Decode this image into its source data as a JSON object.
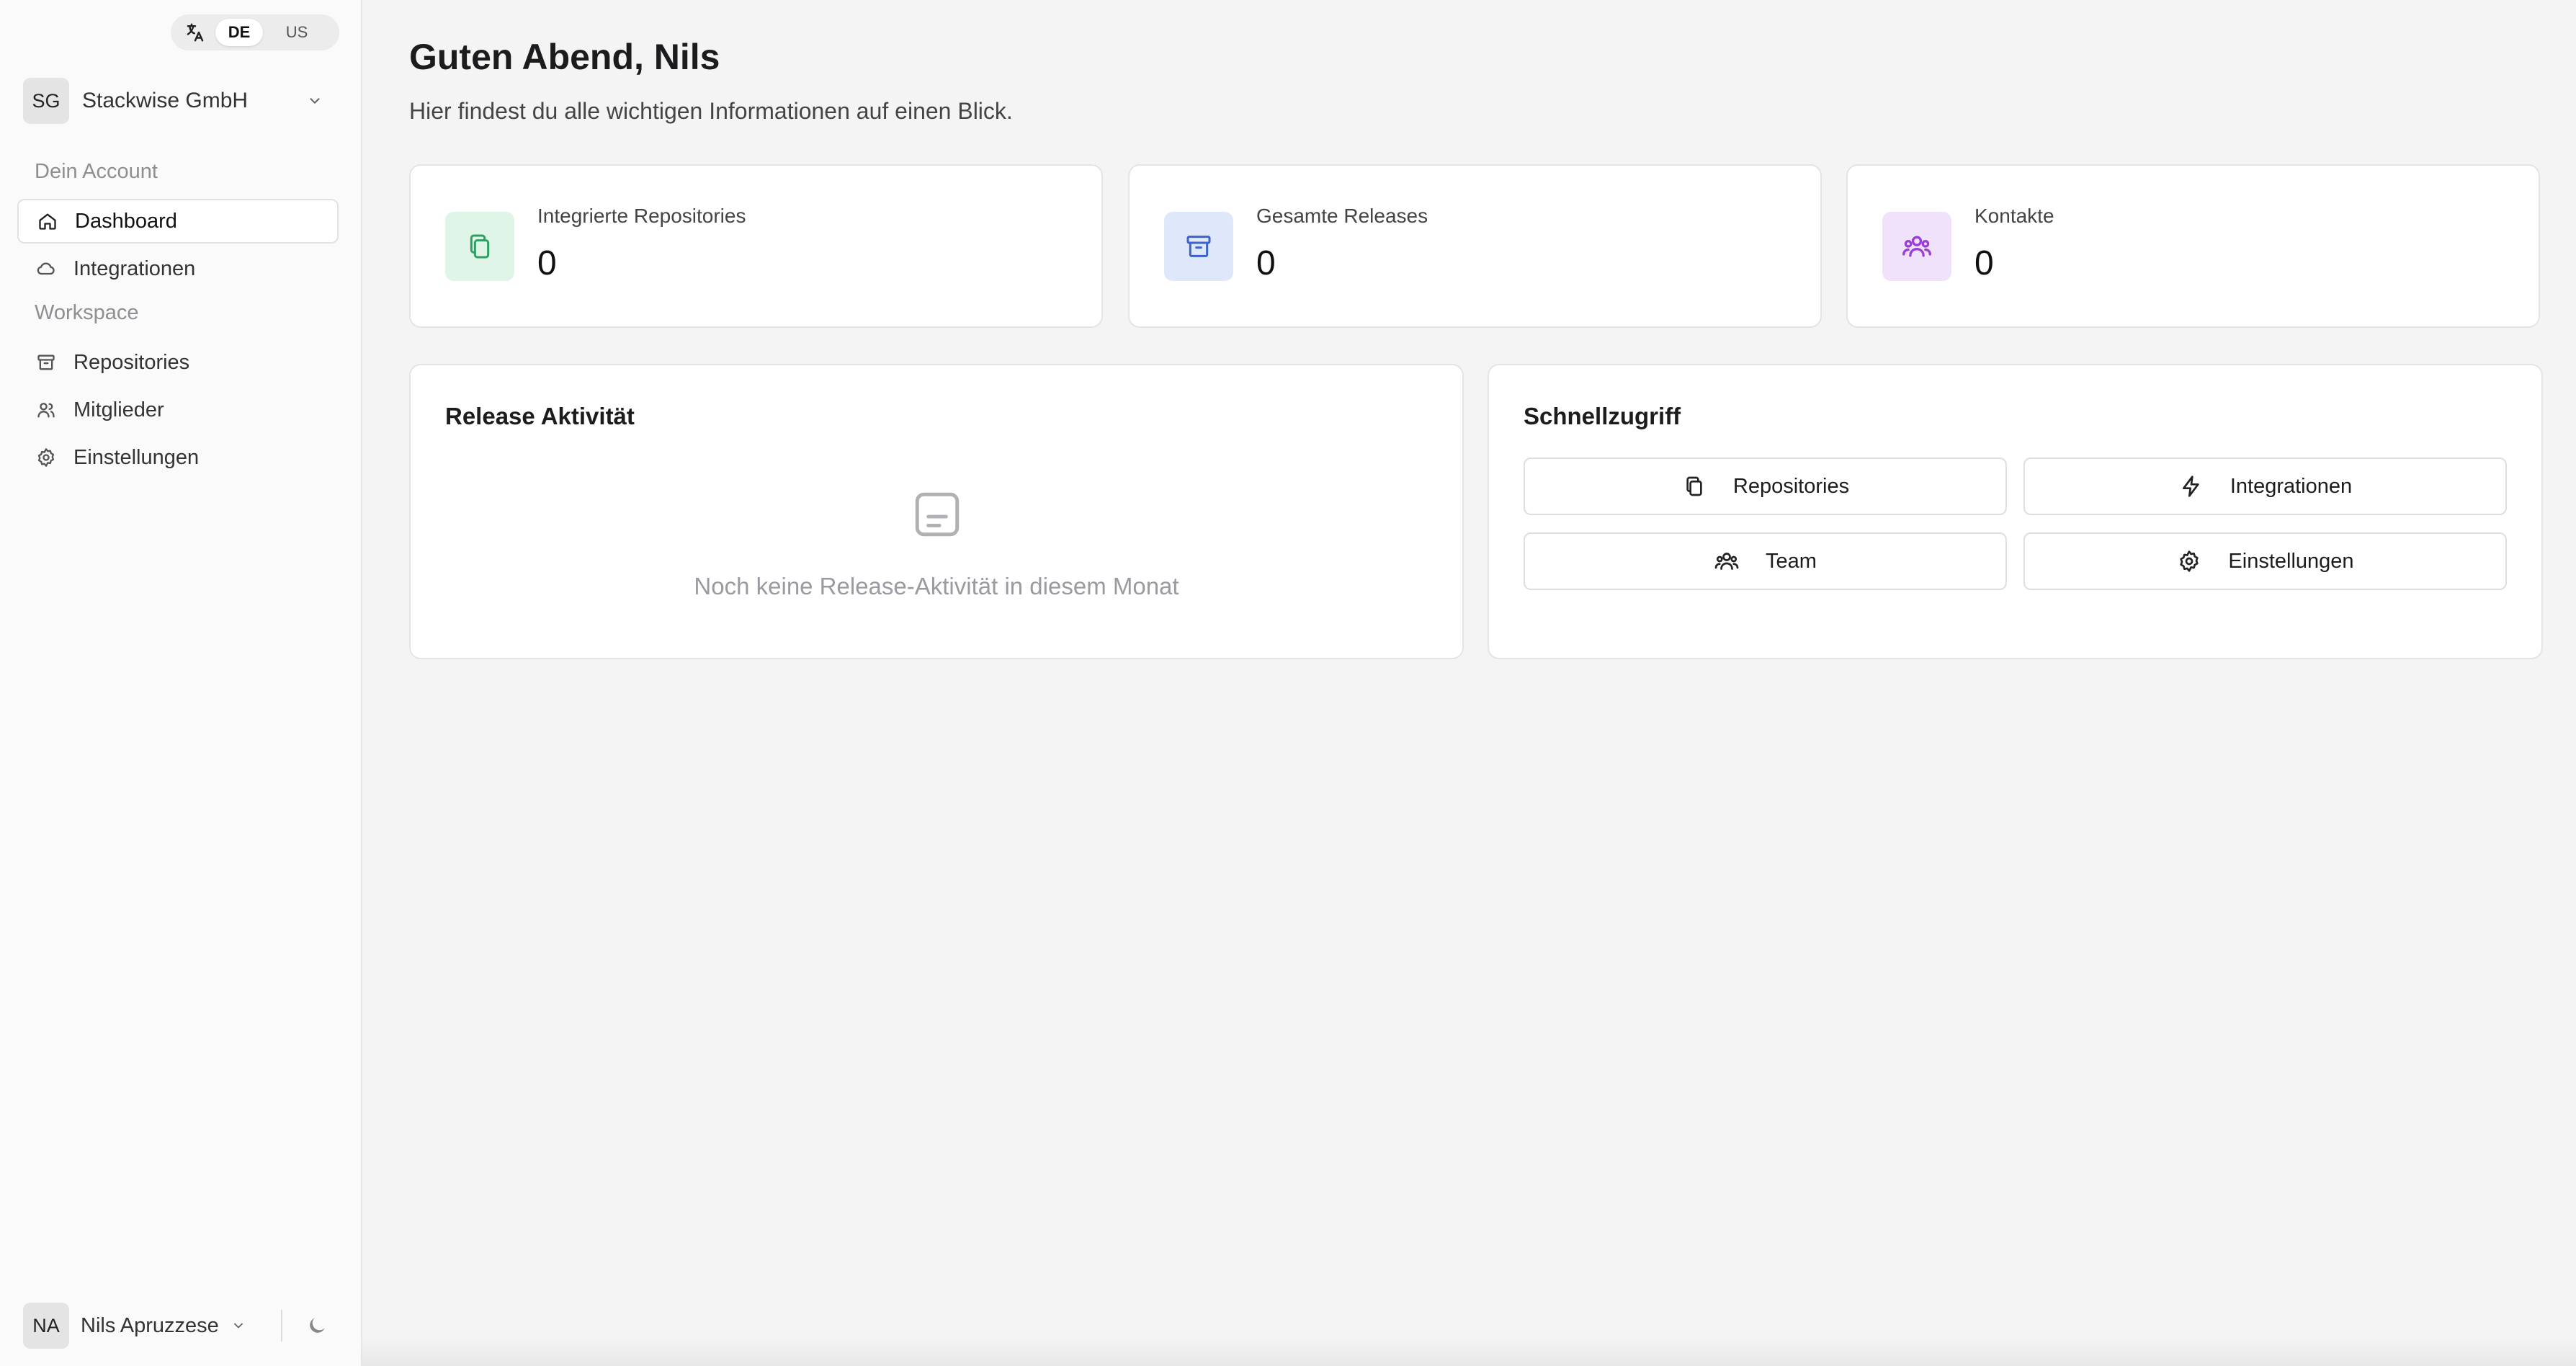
{
  "language_switch": {
    "icon": "translate-icon",
    "options": [
      "DE",
      "US"
    ],
    "active": "DE"
  },
  "organization": {
    "initials": "SG",
    "name": "Stackwise GmbH"
  },
  "sidebar": {
    "sections": [
      {
        "label": "Dein Account",
        "items": [
          {
            "label": "Dashboard",
            "icon": "home-icon",
            "active": true
          },
          {
            "label": "Integrationen",
            "icon": "cloud-icon",
            "active": false
          }
        ]
      },
      {
        "label": "Workspace",
        "items": [
          {
            "label": "Repositories",
            "icon": "archive-icon",
            "active": false
          },
          {
            "label": "Mitglieder",
            "icon": "users-icon",
            "active": false
          },
          {
            "label": "Einstellungen",
            "icon": "gear-icon",
            "active": false
          }
        ]
      }
    ]
  },
  "user": {
    "initials": "NA",
    "name": "Nils Apruzzese",
    "theme_icon": "moon-icon"
  },
  "header": {
    "title": "Guten Abend, Nils",
    "subtitle": "Hier findest du alle wichtigen Informationen auf einen Blick."
  },
  "stats": [
    {
      "label": "Integrierte Repositories",
      "value": "0",
      "icon": "copy-icon",
      "color": "#2e9e64",
      "bg": "#def5e8"
    },
    {
      "label": "Gesamte Releases",
      "value": "0",
      "icon": "archive-icon",
      "color": "#3b63c8",
      "bg": "#dfe8fb"
    },
    {
      "label": "Kontakte",
      "value": "0",
      "icon": "users-icon",
      "color": "#9a3fd6",
      "bg": "#f1e2fb"
    }
  ],
  "release_activity": {
    "title": "Release Aktivität",
    "empty_icon": "note-icon",
    "empty_text": "Noch keine Release-Aktivität in diesem Monat"
  },
  "quick_access": {
    "title": "Schnellzugriff",
    "buttons": [
      {
        "label": "Repositories",
        "icon": "copy-icon"
      },
      {
        "label": "Integrationen",
        "icon": "bolt-icon"
      },
      {
        "label": "Team",
        "icon": "users-icon"
      },
      {
        "label": "Einstellungen",
        "icon": "gear-icon"
      }
    ]
  }
}
